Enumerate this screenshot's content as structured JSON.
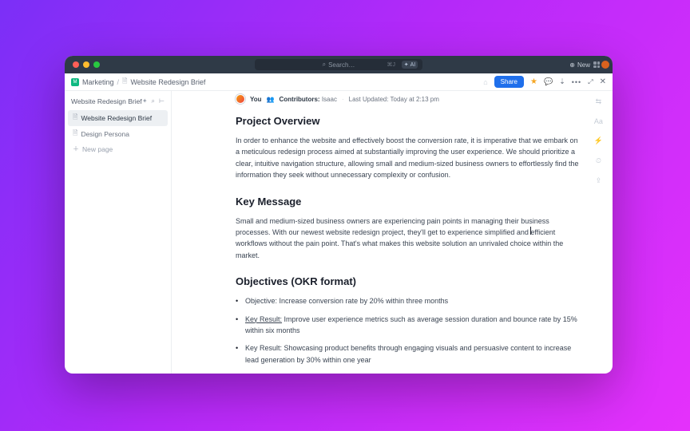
{
  "titlebar": {
    "search_placeholder": "Search…",
    "search_kbd": "⌘J",
    "ai_label": "AI",
    "new_label": "New"
  },
  "breadcrumb": {
    "workspace": "Marketing",
    "page": "Website Redesign Brief",
    "share_label": "Share"
  },
  "sidebar": {
    "title": "Website Redesign Brief",
    "items": [
      {
        "label": "Website Redesign Brief"
      },
      {
        "label": "Design Persona"
      }
    ],
    "new_page_label": "New page"
  },
  "meta": {
    "you": "You",
    "contributors_label": "Contributors:",
    "contributors": "Isaac",
    "updated_label": "Last Updated:",
    "updated_value": "Today at 2:13 pm"
  },
  "sections": {
    "overview_title": "Project Overview",
    "overview_body": "In order to enhance the website and effectively boost the conversion rate, it is imperative that we embark on a meticulous redesign process aimed at substantially improving the user experience. We should prioritize a clear, intuitive navigation structure, allowing small and medium-sized business owners to effortlessly find the information they seek without unnecessary complexity or confusion.",
    "keymsg_title": "Key Message",
    "keymsg_body": "Small and medium-sized business owners are experiencing pain points in managing their business processes. With our newest website redesign project, they'll get to experience simplified and efficient workflows without the pain point. That's what makes this website solution an unrivaled choice within the market.",
    "objectives_title": "Objectives (OKR format)",
    "obj1": "Objective: Increase conversion rate by 20% within three months",
    "obj2_prefix": "Key Result:",
    "obj2_rest": " Improve user experience metrics such as average session duration and bounce rate by 15% within six months",
    "obj3": "Key Result: Showcasing product benefits through engaging visuals and persuasive content to increase lead generation by 30% within one year"
  }
}
